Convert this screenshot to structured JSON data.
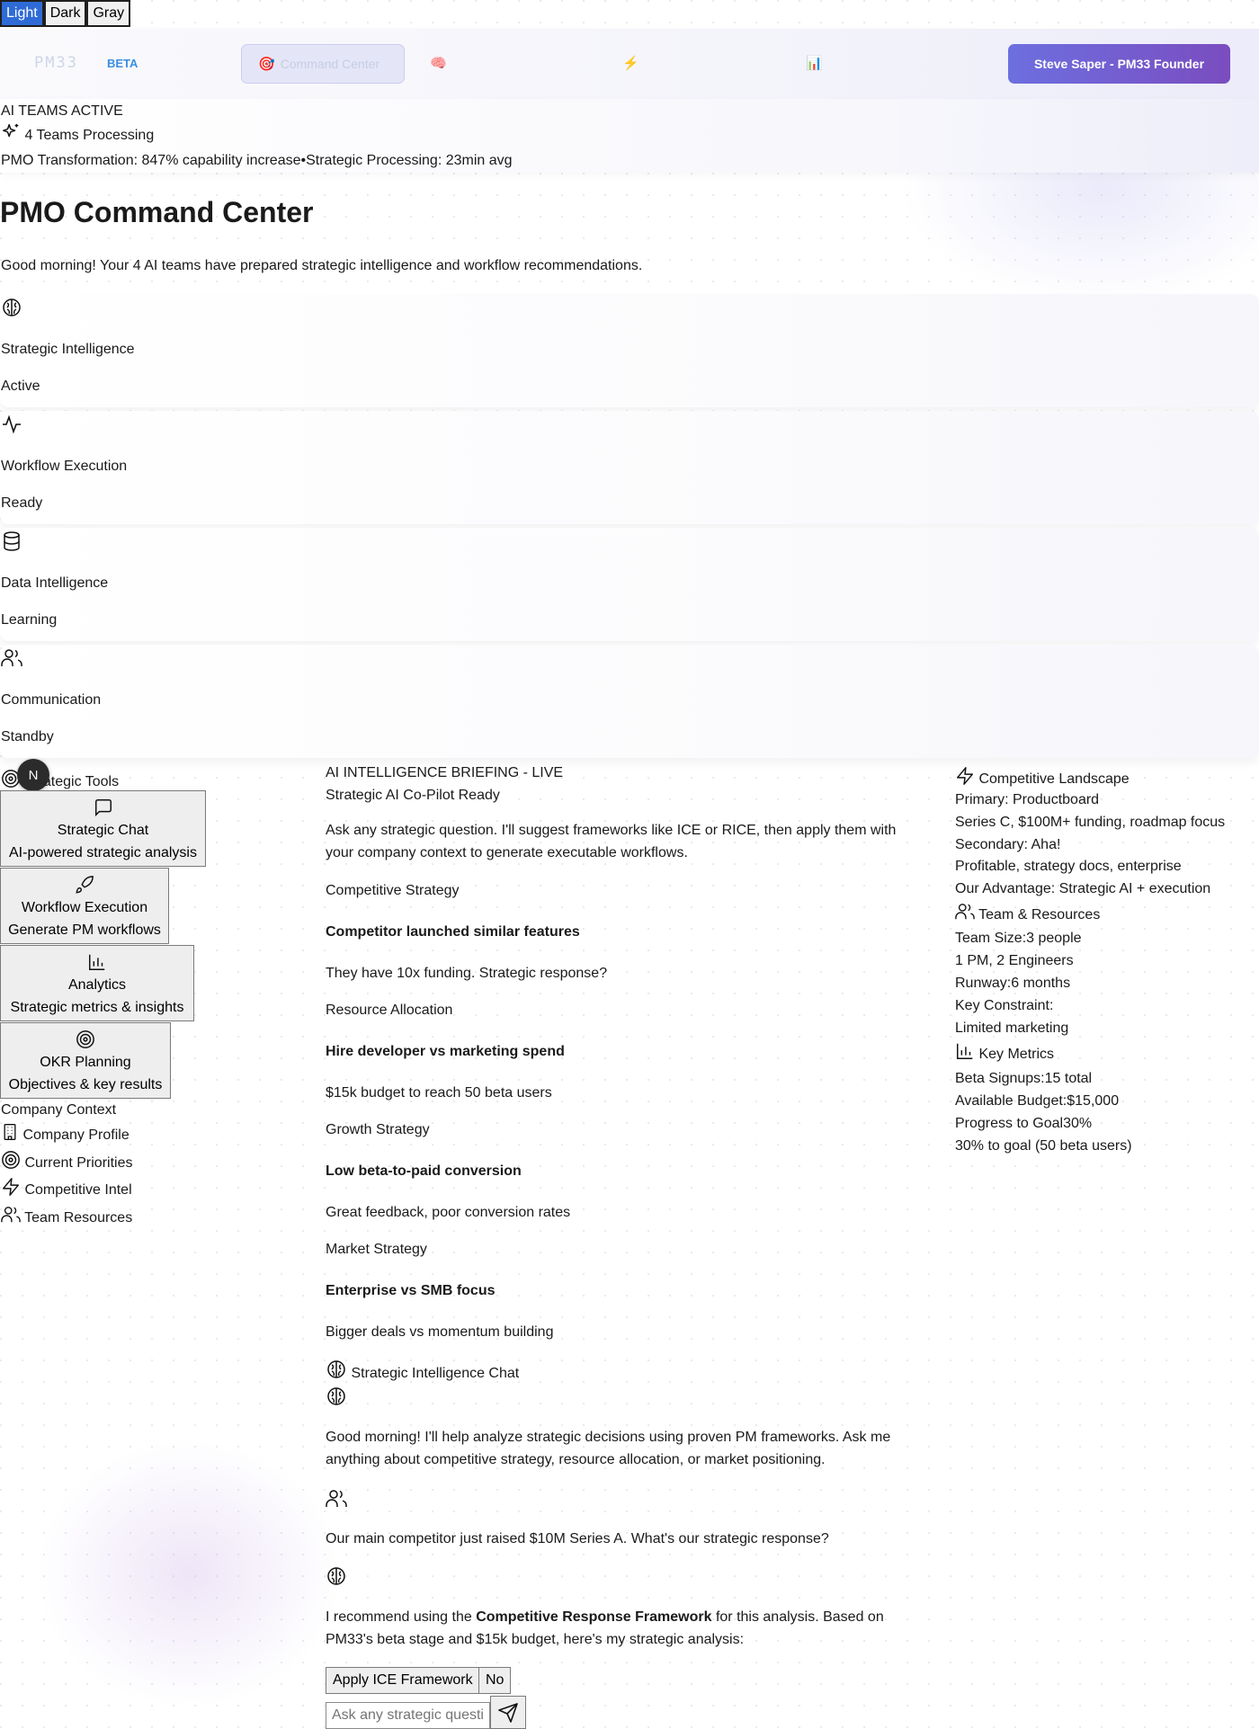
{
  "theme": {
    "options": [
      "Light",
      "Dark",
      "Gray"
    ],
    "active": "Light"
  },
  "header": {
    "logo": "PM33",
    "beta": "BETA",
    "nav": [
      {
        "emoji": "🎯",
        "label": "Command Center",
        "active": true
      },
      {
        "emoji": "🧠",
        "label": "",
        "active": false
      },
      {
        "emoji": "⚡",
        "label": "",
        "active": false
      },
      {
        "emoji": "📊",
        "label": "",
        "active": false
      }
    ],
    "user_button": "Steve Saper - PM33 Founder"
  },
  "teams_status": {
    "heading": "AI TEAMS ACTIVE",
    "processing": "4 Teams Processing",
    "transformation": "PMO Transformation: 847% capability increase",
    "separator": "•",
    "processing_time": "Strategic Processing: 23min avg"
  },
  "page": {
    "title": "PMO Command Center",
    "subtitle": "Good morning! Your 4 AI teams have prepared strategic intelligence and workflow recommendations."
  },
  "teams": [
    {
      "name": "Strategic Intelligence",
      "status": "Active",
      "icon": "brain-icon"
    },
    {
      "name": "Workflow Execution",
      "status": "Ready",
      "icon": "activity-icon"
    },
    {
      "name": "Data Intelligence",
      "status": "Learning",
      "icon": "database-icon"
    },
    {
      "name": "Communication",
      "status": "Standby",
      "icon": "users-icon"
    }
  ],
  "left": {
    "tools_heading": "Strategic Tools",
    "tools": [
      {
        "title": "Strategic Chat",
        "desc": "AI-powered strategic analysis",
        "icon": "chat-icon"
      },
      {
        "title": "Workflow Execution",
        "desc": "Generate PM workflows",
        "icon": "rocket-icon"
      },
      {
        "title": "Analytics",
        "desc": "Strategic metrics & insights",
        "icon": "bar-chart-icon"
      },
      {
        "title": "OKR Planning",
        "desc": "Objectives & key results",
        "icon": "target-icon"
      }
    ],
    "context_heading": "Company Context",
    "context": [
      {
        "label": "Company Profile",
        "icon": "building-icon"
      },
      {
        "label": "Current Priorities",
        "icon": "target-icon"
      },
      {
        "label": "Competitive Intel",
        "icon": "lightning-icon"
      },
      {
        "label": "Team Resources",
        "icon": "users-icon"
      }
    ],
    "avatar": "N"
  },
  "center": {
    "briefing": "AI INTELLIGENCE BRIEFING - LIVE",
    "copilot": "Strategic AI Co-Pilot Ready",
    "intro_1": "Ask any strategic question. I'll suggest frameworks like ICE or RICE, then apply them with",
    "intro_2": "your company context to generate executable workflows.",
    "scenarios": [
      {
        "category": "Competitive Strategy",
        "title": "Competitor launched similar features",
        "desc": "They have 10x funding. Strategic response?"
      },
      {
        "category": "Resource Allocation",
        "title": "Hire developer vs marketing spend",
        "desc": "$15k budget to reach 50 beta users"
      },
      {
        "category": "Growth Strategy",
        "title": "Low beta-to-paid conversion",
        "desc": "Great feedback, poor conversion rates"
      },
      {
        "category": "Market Strategy",
        "title": "Enterprise vs SMB focus",
        "desc": "Bigger deals vs momentum building"
      }
    ],
    "chat_title": "Strategic Intelligence Chat",
    "messages": {
      "ai1_l1": "Good morning! I'll help analyze strategic decisions using proven PM frameworks. Ask me",
      "ai1_l2": "anything about competitive strategy, resource allocation, or market positioning.",
      "user": "Our main competitor just raised $10M Series A. What's our strategic response?",
      "ai2_pre": "I recommend using the ",
      "ai2_bold": "Competitive Response Framework",
      "ai2_post": " for this analysis. Based on",
      "ai2_l2": "PM33's beta stage and $15k budget, here's my strategic analysis:"
    },
    "actions": {
      "apply": "Apply ICE Framework",
      "no": "No"
    },
    "input_placeholder": "Ask any strategic question..."
  },
  "right": {
    "competitive": {
      "heading": "Competitive Landscape",
      "primary": "Primary: Productboard",
      "primary_desc": "Series C, $100M+ funding, roadmap focus",
      "secondary": "Secondary: Aha!",
      "secondary_desc": "Profitable, strategy docs, enterprise",
      "advantage": "Our Advantage: Strategic AI + execution"
    },
    "team": {
      "heading": "Team & Resources",
      "size_label": "Team Size:",
      "size_value": "3 people",
      "composition": "1 PM, 2 Engineers",
      "runway_label": "Runway:",
      "runway_value": "6 months",
      "constraint_label": "Key Constraint:",
      "constraint_value": "Limited marketing"
    },
    "metrics": {
      "heading": "Key Metrics",
      "signups_label": "Beta Signups:",
      "signups_value": "15 total",
      "budget_label": "Available Budget:",
      "budget_value": "$15,000",
      "progress_label": "Progress to Goal",
      "progress_value": "30%",
      "goal_note": "30% to goal (50 beta users)"
    }
  }
}
